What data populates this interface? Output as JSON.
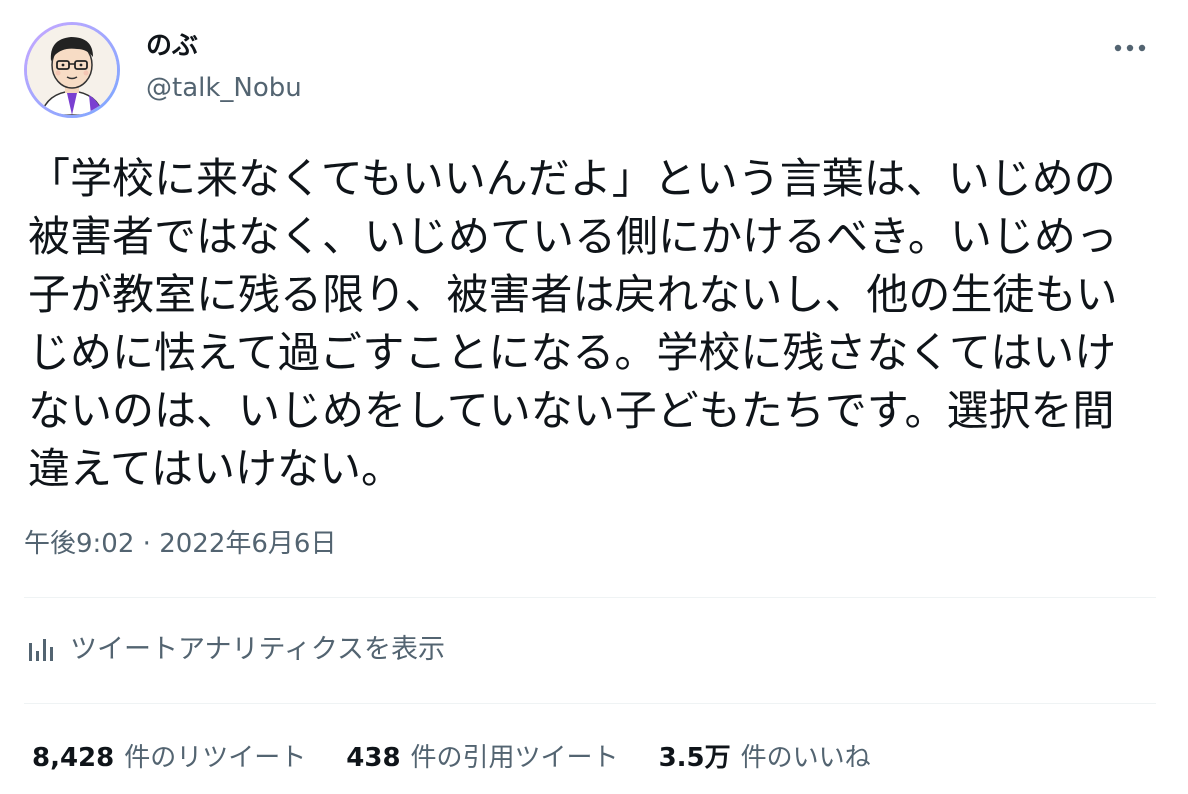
{
  "user": {
    "display_name": "のぶ",
    "handle": "@talk_Nobu",
    "avatar_icon": "avatar-illustration-man-with-glasses"
  },
  "menu": {
    "icon": "more-horizontal-icon"
  },
  "tweet": {
    "text": "「学校に来なくてもいいんだよ」という言葉は、いじめの被害者ではなく、いじめている側にかけるべき。いじめっ子が教室に残る限り、被害者は戻れないし、他の生徒もいじめに怯えて過ごすことになる。学校に残さなくてはいけないのは、いじめをしていない子どもたちです。選択を間違えてはいけない。",
    "time": "午後9:02",
    "separator": "·",
    "date": "2022年6月6日"
  },
  "analytics": {
    "icon": "bar-chart-icon",
    "label": "ツイートアナリティクスを表示"
  },
  "stats": [
    {
      "value": "8,428",
      "label": "件のリツイート"
    },
    {
      "value": "438",
      "label": "件の引用ツイート"
    },
    {
      "value": "3.5万",
      "label": "件のいいね"
    }
  ],
  "colors": {
    "text_primary": "#0f1419",
    "text_secondary": "#536471",
    "divider": "#eff3f4"
  }
}
